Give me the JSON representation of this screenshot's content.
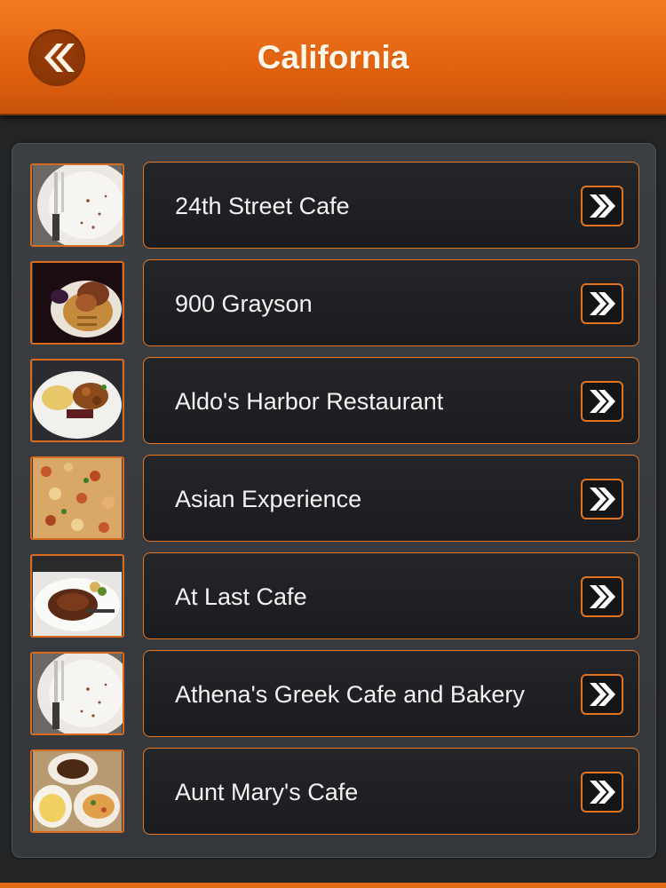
{
  "header": {
    "title": "California",
    "back_icon": "double-chevron-left-icon",
    "accent": "#e1620f"
  },
  "list": {
    "item_icon": "double-chevron-right-icon",
    "border_color": "#e3741f",
    "items": [
      {
        "label": "24th Street Cafe",
        "thumb": "plate-fork-photo"
      },
      {
        "label": "900 Grayson",
        "thumb": "waffle-chicken-photo"
      },
      {
        "label": "Aldo's Harbor Restaurant",
        "thumb": "breakfast-plate-photo"
      },
      {
        "label": "Asian Experience",
        "thumb": "fried-rice-photo"
      },
      {
        "label": "At Last Cafe",
        "thumb": "steak-plate-photo"
      },
      {
        "label": "Athena's Greek Cafe and Bakery",
        "thumb": "plate-fork-photo"
      },
      {
        "label": "Aunt Mary's Cafe",
        "thumb": "brunch-table-photo"
      }
    ]
  }
}
